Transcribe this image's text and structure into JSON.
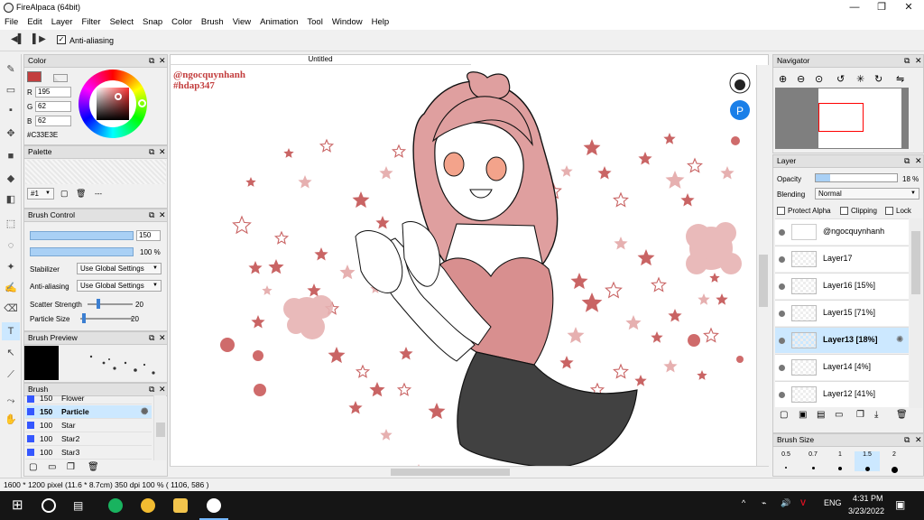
{
  "window": {
    "title": "FireAlpaca (64bit)",
    "min_glyph": "—",
    "max_glyph": "❐",
    "close_glyph": "✕"
  },
  "menu": [
    "File",
    "Edit",
    "Layer",
    "Filter",
    "Select",
    "Snap",
    "Color",
    "Brush",
    "View",
    "Animation",
    "Tool",
    "Window",
    "Help"
  ],
  "tool_options": {
    "anti_aliasing": "Anti-aliasing"
  },
  "panels": {
    "color": {
      "title": "Color",
      "r_label": "R",
      "g_label": "G",
      "b_label": "B",
      "r_value": "195",
      "g_value": "62",
      "b_value": "62",
      "hex": "#C33E3E",
      "current_color": "#C33E3E"
    },
    "palette": {
      "title": "Palette",
      "selector": "#1",
      "dash": "---"
    },
    "brush_control": {
      "title": "Brush Control",
      "size_value": "150",
      "size_fill": 1.0,
      "opacity_value": "100 %",
      "opacity_fill": 1.0,
      "stabilizer_label": "Stabilizer",
      "stabilizer_value": "Use Global Settings",
      "anti_alias_label": "Anti-aliasing",
      "anti_alias_value": "Use Global Settings",
      "scatter_label": "Scatter Strength",
      "scatter_value": "20",
      "scatter_fill": 0.2,
      "particle_label": "Particle Size",
      "particle_value": "20",
      "particle_fill": 0.2
    },
    "brush_preview": {
      "title": "Brush Preview"
    },
    "brush": {
      "title": "Brush",
      "items": [
        {
          "size": "150",
          "name": "Flower"
        },
        {
          "size": "150",
          "name": "Particle"
        },
        {
          "size": "100",
          "name": "Star"
        },
        {
          "size": "100",
          "name": "Star2"
        },
        {
          "size": "100",
          "name": "Star3"
        }
      ]
    },
    "navigator": {
      "title": "Navigator"
    },
    "layer": {
      "title": "Layer",
      "opacity_label": "Opacity",
      "opacity_value": "18 %",
      "opacity_fill": 0.18,
      "blending_label": "Blending",
      "blending_value": "Normal",
      "protect_alpha": "Protect Alpha",
      "clipping": "Clipping",
      "lock": "Lock",
      "items": [
        "@ngocquynhanh",
        "Layer17",
        "Layer16 [15%]",
        "Layer15 [71%]",
        "Layer13 [18%]",
        "Layer14 [4%]",
        "Layer12 [41%]"
      ]
    },
    "brush_size": {
      "title": "Brush Size",
      "values": [
        "0.5",
        "0.7",
        "1",
        "1.5",
        "2"
      ]
    }
  },
  "canvas": {
    "tab_title": "Untitled",
    "watermark1": "@ngocquynhanh",
    "watermark2": "#hdap347"
  },
  "status": "1600 * 1200 pixel   (11.6 * 8.7cm)   350 dpi   100 %   ( 1106, 586 )",
  "taskbar": {
    "lang": "ENG",
    "time": "4:31 PM",
    "date": "3/23/2022"
  },
  "colors": {
    "accent": "#cce8ff",
    "star": "#c96464",
    "skirt": "#414141",
    "top": "#d88f8f",
    "hair": "#df9f9f"
  }
}
